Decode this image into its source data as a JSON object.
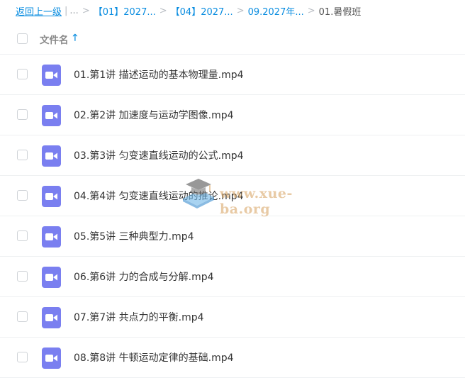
{
  "breadcrumb": {
    "back_label": "返回上一级",
    "ellipsis": "...",
    "items": [
      "【01】2027...",
      "【04】2027...",
      "09.2027年..."
    ],
    "current": "01.暑假班"
  },
  "header": {
    "name_column": "文件名",
    "sort_icon": "arrow-up-icon"
  },
  "files": [
    {
      "name": "01.第1讲 描述运动的基本物理量.mp4"
    },
    {
      "name": "02.第2讲 加速度与运动学图像.mp4"
    },
    {
      "name": "03.第3讲 匀变速直线运动的公式.mp4"
    },
    {
      "name": "04.第4讲 匀变速直线运动的推论.mp4"
    },
    {
      "name": "05.第5讲 三种典型力.mp4"
    },
    {
      "name": "06.第6讲 力的合成与分解.mp4"
    },
    {
      "name": "07.第7讲 共点力的平衡.mp4"
    },
    {
      "name": "08.第8讲 牛顿运动定律的基础.mp4"
    }
  ],
  "watermark": {
    "text": "www.xue-ba.org"
  },
  "colors": {
    "accent": "#0a8de0",
    "video_icon": "#7a7ff0"
  }
}
